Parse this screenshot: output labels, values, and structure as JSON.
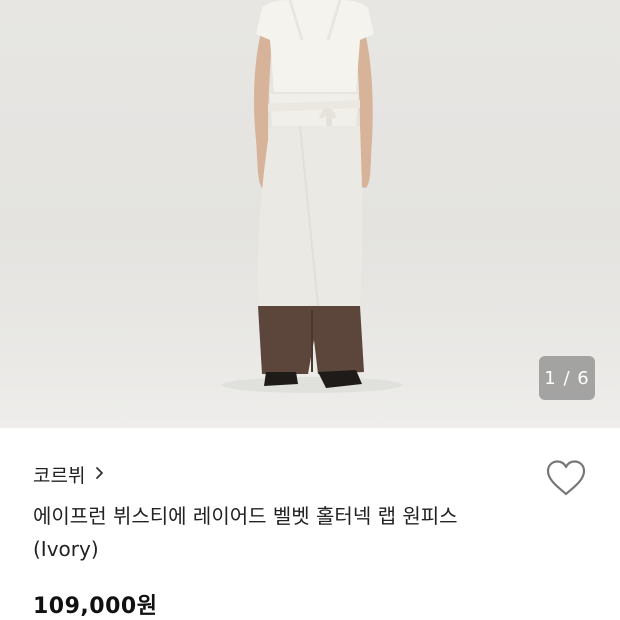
{
  "gallery": {
    "counter": "1 / 6",
    "image_alt": "model wearing ivory layered halter-neck wrap dress over brown trousers"
  },
  "product": {
    "brand": "코르뷔",
    "name_line1": "에이프런 뷔스티에 레이어드 벨벳 홀터넥 랩 원피스",
    "name_line2": "(Ivory)",
    "price": "109,000원"
  },
  "icons": {
    "brand_chevron": "chevron-right-icon",
    "like": "heart-outline-icon"
  },
  "colors": {
    "text": "#222222",
    "price": "#111111",
    "counter_bg": "#787878"
  }
}
